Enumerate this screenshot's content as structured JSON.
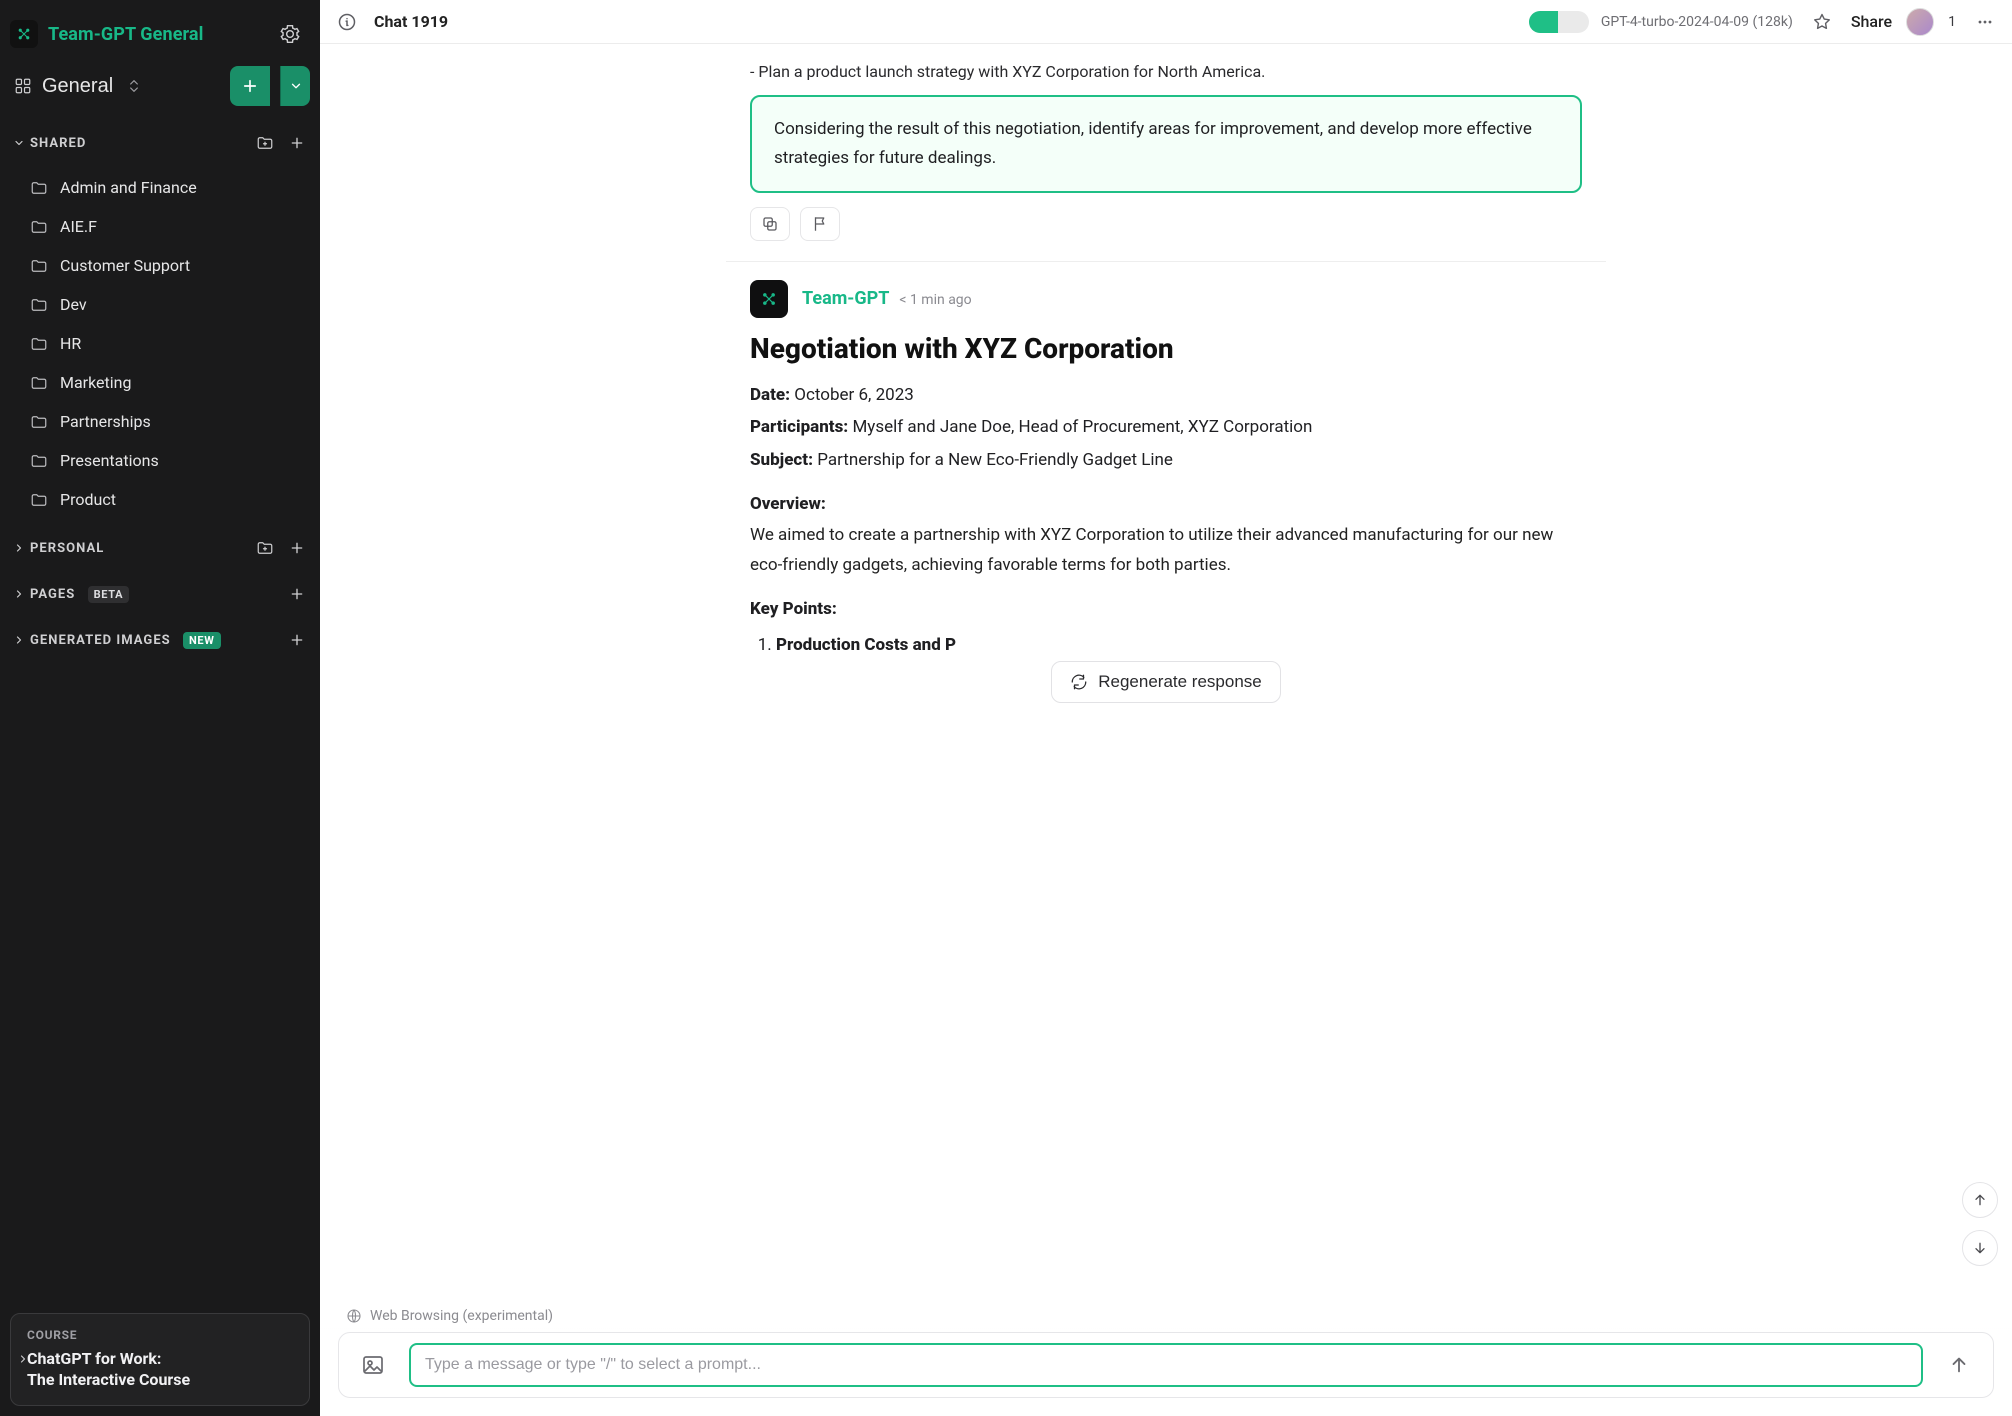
{
  "brand": {
    "name": "Team-GPT General"
  },
  "workspace": {
    "name": "General"
  },
  "sections": {
    "shared": {
      "title": "SHARED"
    },
    "personal": {
      "title": "PERSONAL"
    },
    "pages": {
      "title": "PAGES",
      "badge": "BETA"
    },
    "images": {
      "title": "GENERATED IMAGES",
      "badge": "NEW"
    }
  },
  "folders": [
    {
      "label": "Admin and Finance"
    },
    {
      "label": "AIE.F"
    },
    {
      "label": "Customer Support"
    },
    {
      "label": "Dev"
    },
    {
      "label": "HR"
    },
    {
      "label": "Marketing"
    },
    {
      "label": "Partnerships"
    },
    {
      "label": "Presentations"
    },
    {
      "label": "Product"
    }
  ],
  "course": {
    "kicker": "COURSE",
    "title_line1": "ChatGPT for Work:",
    "title_line2": "The Interactive Course"
  },
  "topbar": {
    "title": "Chat 1919",
    "context_pct": 48,
    "model": "GPT-4-turbo-2024-04-09 (128k)",
    "share": "Share",
    "avatar_count": "1"
  },
  "prev_trailing": {
    "line2": "- Plan a product launch strategy with XYZ Corporation for North America."
  },
  "callout": "Considering the result of this negotiation, identify areas for improvement, and develop more effective strategies for future dealings.",
  "bot": {
    "name": "Team-GPT",
    "time": "< 1 min ago"
  },
  "msg": {
    "title": "Negotiation with XYZ Corporation",
    "date_k": "Date:",
    "date_v": " October 6, 2023",
    "participants_k": "Participants:",
    "participants_v": " Myself and Jane Doe, Head of Procurement, XYZ Corporation",
    "subject_k": "Subject:",
    "subject_v": " Partnership for a New Eco-Friendly Gadget Line",
    "overview_k": "Overview:",
    "overview_v": "We aimed to create a partnership with XYZ Corporation to utilize their advanced manufacturing for our new eco-friendly gadgets, achieving favorable terms for both parties.",
    "keypoints_k": "Key Points:",
    "kp1_k": "Production Costs and P",
    "kp1_rest": ""
  },
  "regen": "Regenerate response",
  "composer": {
    "browse_note": "Web Browsing (experimental)",
    "placeholder": "Type a message or type \"/\" to select a prompt..."
  }
}
